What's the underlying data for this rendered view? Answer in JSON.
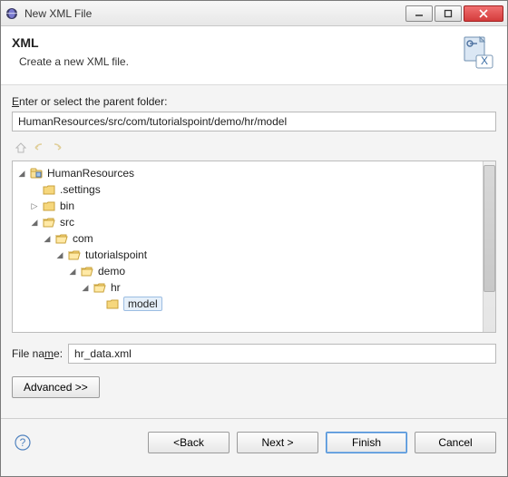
{
  "titlebar": {
    "title": "New XML File"
  },
  "banner": {
    "title": "XML",
    "subtitle": "Create a new XML file."
  },
  "parent": {
    "label_pre": "E",
    "label_rest": "nter or select the parent folder:",
    "value": "HumanResources/src/com/tutorialspoint/demo/hr/model"
  },
  "tree": {
    "nodes": [
      {
        "label": "HumanResources",
        "depth": 0,
        "exp": "open",
        "icon": "project"
      },
      {
        "label": ".settings",
        "depth": 1,
        "exp": "none",
        "icon": "folder"
      },
      {
        "label": "bin",
        "depth": 1,
        "exp": "closed",
        "icon": "folder"
      },
      {
        "label": "src",
        "depth": 1,
        "exp": "open",
        "icon": "folder-open"
      },
      {
        "label": "com",
        "depth": 2,
        "exp": "open",
        "icon": "folder-open"
      },
      {
        "label": "tutorialspoint",
        "depth": 3,
        "exp": "open",
        "icon": "folder-open"
      },
      {
        "label": "demo",
        "depth": 4,
        "exp": "open",
        "icon": "folder-open"
      },
      {
        "label": "hr",
        "depth": 5,
        "exp": "open",
        "icon": "folder-open"
      },
      {
        "label": "model",
        "depth": 6,
        "exp": "none",
        "icon": "folder",
        "selected": true
      }
    ]
  },
  "filename": {
    "label_pre": "File na",
    "label_u": "m",
    "label_post": "e:",
    "value": "hr_data.xml"
  },
  "advanced": {
    "label": "Advanced >>"
  },
  "footer": {
    "back": "< Back",
    "next": "Next >",
    "finish": "Finish",
    "cancel": "Cancel"
  }
}
